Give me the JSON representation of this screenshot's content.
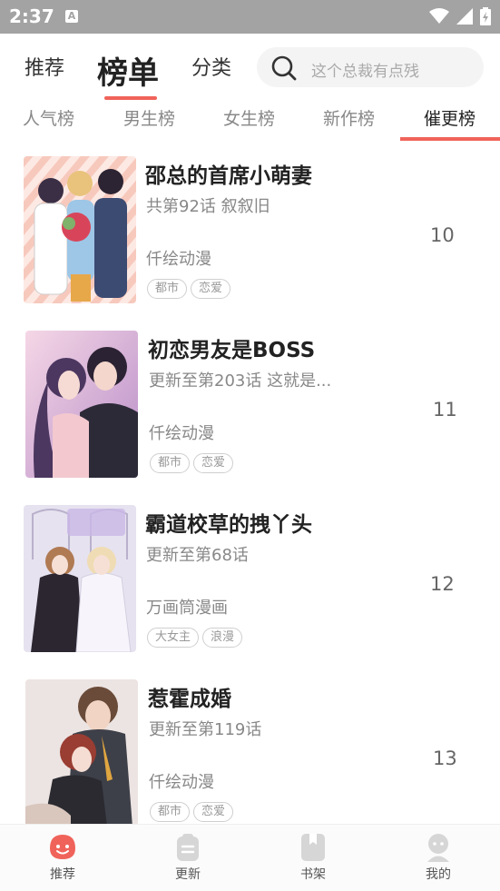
{
  "status_bar": {
    "time": "2:37",
    "notification_letter": "A"
  },
  "top_nav": {
    "tabs": [
      {
        "label": "推荐"
      },
      {
        "label": "榜单"
      },
      {
        "label": "分类"
      }
    ],
    "active_tab": "榜单",
    "search": {
      "placeholder": "这个总裁有点残"
    }
  },
  "rank_tabs": {
    "tabs": [
      {
        "label": "人气榜"
      },
      {
        "label": "男生榜"
      },
      {
        "label": "女生榜"
      },
      {
        "label": "新作榜"
      },
      {
        "label": "催更榜"
      }
    ],
    "active_tab": "催更榜"
  },
  "comics": [
    {
      "title": "邵总的首席小萌妻",
      "subtitle": "共第92话 叙叙旧",
      "author": "仟绘动漫",
      "tags": [
        "都市",
        "恋爱"
      ],
      "rank": "10"
    },
    {
      "title": "初恋男友是BOSS",
      "subtitle": "更新至第203话 这就是...",
      "author": "仟绘动漫",
      "tags": [
        "都市",
        "恋爱"
      ],
      "rank": "11"
    },
    {
      "title": "霸道校草的拽丫头",
      "subtitle": "更新至第68话",
      "author": "万画筒漫画",
      "tags": [
        "大女主",
        "浪漫"
      ],
      "rank": "12"
    },
    {
      "title": "惹霍成婚",
      "subtitle": "更新至第119话",
      "author": "仟绘动漫",
      "tags": [
        "都市",
        "恋爱"
      ],
      "rank": "13"
    }
  ],
  "bottom_nav": {
    "items": [
      {
        "label": "推荐",
        "icon": "smile-bubble-icon"
      },
      {
        "label": "更新",
        "icon": "clipboard-icon"
      },
      {
        "label": "书架",
        "icon": "bookmark-book-icon"
      },
      {
        "label": "我的",
        "icon": "user-icon"
      }
    ],
    "active": "推荐"
  },
  "colors": {
    "accent": "#f0635a",
    "status_bar": "#a3a3a3",
    "inactive_icon": "#d6d6d6"
  }
}
